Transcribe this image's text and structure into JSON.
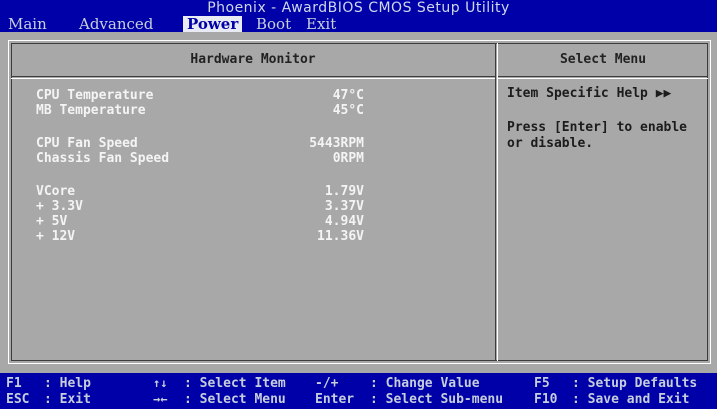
{
  "title": "Phoenix - AwardBIOS CMOS Setup Utility",
  "menu": {
    "main": "Main",
    "advanced": "Advanced",
    "power": "Power",
    "boot": "Boot",
    "exit": "Exit",
    "active": "Power"
  },
  "panel": {
    "title": "Hardware Monitor",
    "rows": [
      {
        "label": "CPU Temperature",
        "value": "47°C"
      },
      {
        "label": "MB Temperature",
        "value": "45°C"
      },
      {
        "label": "CPU Fan Speed",
        "value": "5443RPM"
      },
      {
        "label": "Chassis Fan Speed",
        "value": "0RPM"
      },
      {
        "label": "VCore",
        "value": "1.79V"
      },
      {
        "label": "+ 3.3V",
        "value": "3.37V"
      },
      {
        "label": "+ 5V",
        "value": "4.94V"
      },
      {
        "label": "+ 12V",
        "value": "11.36V"
      }
    ]
  },
  "help": {
    "title": "Select Menu",
    "item_specific": "Item Specific Help",
    "text_line1": "Press [Enter] to enable",
    "text_line2": "or disable."
  },
  "footer": {
    "f1_key": "F1",
    "f1_desc": ": Help",
    "esc_key": "ESC",
    "esc_desc": ": Exit",
    "updown_desc": ": Select Item",
    "leftright_desc": ": Select Menu",
    "pm_key": "-/+",
    "pm_desc": ": Change Value",
    "enter_key": "Enter",
    "enter_desc": ": Select Sub-menu",
    "f5_key": "F5",
    "f5_desc": ": Setup Defaults",
    "f10_key": "F10",
    "f10_desc": ": Save and Exit"
  },
  "icons": {
    "updown": "up-down-arrow-icon",
    "leftright": "left-right-arrow-icon",
    "fastforward": "double-right-arrow-icon"
  },
  "colors": {
    "bar": "#0000a8",
    "background": "#a8a8a8",
    "value_text": "#f4f4f4",
    "highlight": "#e8eaf4"
  }
}
